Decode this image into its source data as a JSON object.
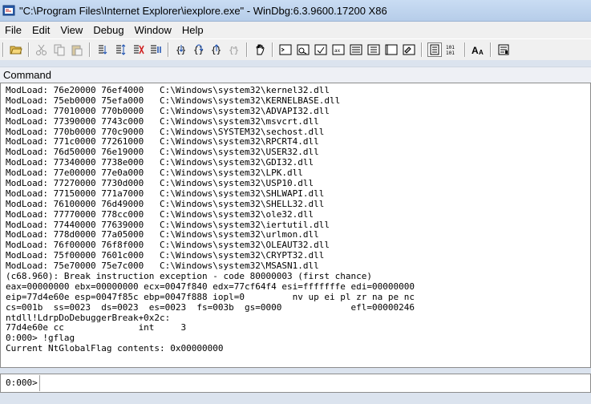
{
  "window": {
    "title": "\"C:\\Program Files\\Internet Explorer\\iexplore.exe\" - WinDbg:6.3.9600.17200 X86"
  },
  "menu": {
    "items": [
      {
        "label": "File"
      },
      {
        "label": "Edit"
      },
      {
        "label": "View"
      },
      {
        "label": "Debug"
      },
      {
        "label": "Window"
      },
      {
        "label": "Help"
      }
    ]
  },
  "toolbar": {
    "buttons": [
      {
        "icon": "open-folder-icon"
      },
      {
        "icon": "cut-icon"
      },
      {
        "icon": "copy-icon"
      },
      {
        "icon": "paste-icon"
      },
      {
        "icon": "go-icon"
      },
      {
        "icon": "restart-icon"
      },
      {
        "icon": "stop-debugging-icon"
      },
      {
        "icon": "break-icon"
      },
      {
        "icon": "step-into-icon"
      },
      {
        "icon": "step-over-icon"
      },
      {
        "icon": "step-out-icon"
      },
      {
        "icon": "run-to-cursor-icon"
      },
      {
        "icon": "insert-breakpoint-icon"
      },
      {
        "icon": "command-window-icon"
      },
      {
        "icon": "watch-window-icon"
      },
      {
        "icon": "locals-window-icon"
      },
      {
        "icon": "registers-window-icon"
      },
      {
        "icon": "memory-window-icon"
      },
      {
        "icon": "call-stack-window-icon"
      },
      {
        "icon": "disassembly-window-icon"
      },
      {
        "icon": "scratch-pad-icon"
      },
      {
        "icon": "source-mode-icon"
      },
      {
        "icon": "hex-status-icon"
      },
      {
        "icon": "font-icon"
      },
      {
        "icon": "options-icon"
      }
    ]
  },
  "command_pane": {
    "header": "Command",
    "output_lines": [
      "ModLoad: 76e20000 76ef4000   C:\\Windows\\system32\\kernel32.dll",
      "ModLoad: 75eb0000 75efa000   C:\\Windows\\system32\\KERNELBASE.dll",
      "ModLoad: 77010000 770b0000   C:\\Windows\\system32\\ADVAPI32.dll",
      "ModLoad: 77390000 7743c000   C:\\Windows\\system32\\msvcrt.dll",
      "ModLoad: 770b0000 770c9000   C:\\Windows\\SYSTEM32\\sechost.dll",
      "ModLoad: 771c0000 77261000   C:\\Windows\\system32\\RPCRT4.dll",
      "ModLoad: 76d50000 76e19000   C:\\Windows\\system32\\USER32.dll",
      "ModLoad: 77340000 7738e000   C:\\Windows\\system32\\GDI32.dll",
      "ModLoad: 77e00000 77e0a000   C:\\Windows\\system32\\LPK.dll",
      "ModLoad: 77270000 7730d000   C:\\Windows\\system32\\USP10.dll",
      "ModLoad: 77150000 771a7000   C:\\Windows\\system32\\SHLWAPI.dll",
      "ModLoad: 76100000 76d49000   C:\\Windows\\system32\\SHELL32.dll",
      "ModLoad: 77770000 778cc000   C:\\Windows\\system32\\ole32.dll",
      "ModLoad: 77440000 77639000   C:\\Windows\\system32\\iertutil.dll",
      "ModLoad: 778d0000 77a05000   C:\\Windows\\system32\\urlmon.dll",
      "ModLoad: 76f00000 76f8f000   C:\\Windows\\system32\\OLEAUT32.dll",
      "ModLoad: 75f00000 7601c000   C:\\Windows\\system32\\CRYPT32.dll",
      "ModLoad: 75e70000 75e7c000   C:\\Windows\\system32\\MSASN1.dll",
      "(c68.960): Break instruction exception - code 80000003 (first chance)",
      "eax=00000000 ebx=00000000 ecx=0047f840 edx=77cf64f4 esi=fffffffe edi=00000000",
      "eip=77d4e60e esp=0047f85c ebp=0047f888 iopl=0         nv up ei pl zr na pe nc",
      "cs=001b  ss=0023  ds=0023  es=0023  fs=003b  gs=0000             efl=00000246",
      "ntdll!LdrpDoDebuggerBreak+0x2c:",
      "77d4e60e cc              int     3",
      "0:000> !gflag",
      "Current NtGlobalFlag contents: 0x00000000"
    ],
    "prompt": "0:000>",
    "input_value": ""
  }
}
